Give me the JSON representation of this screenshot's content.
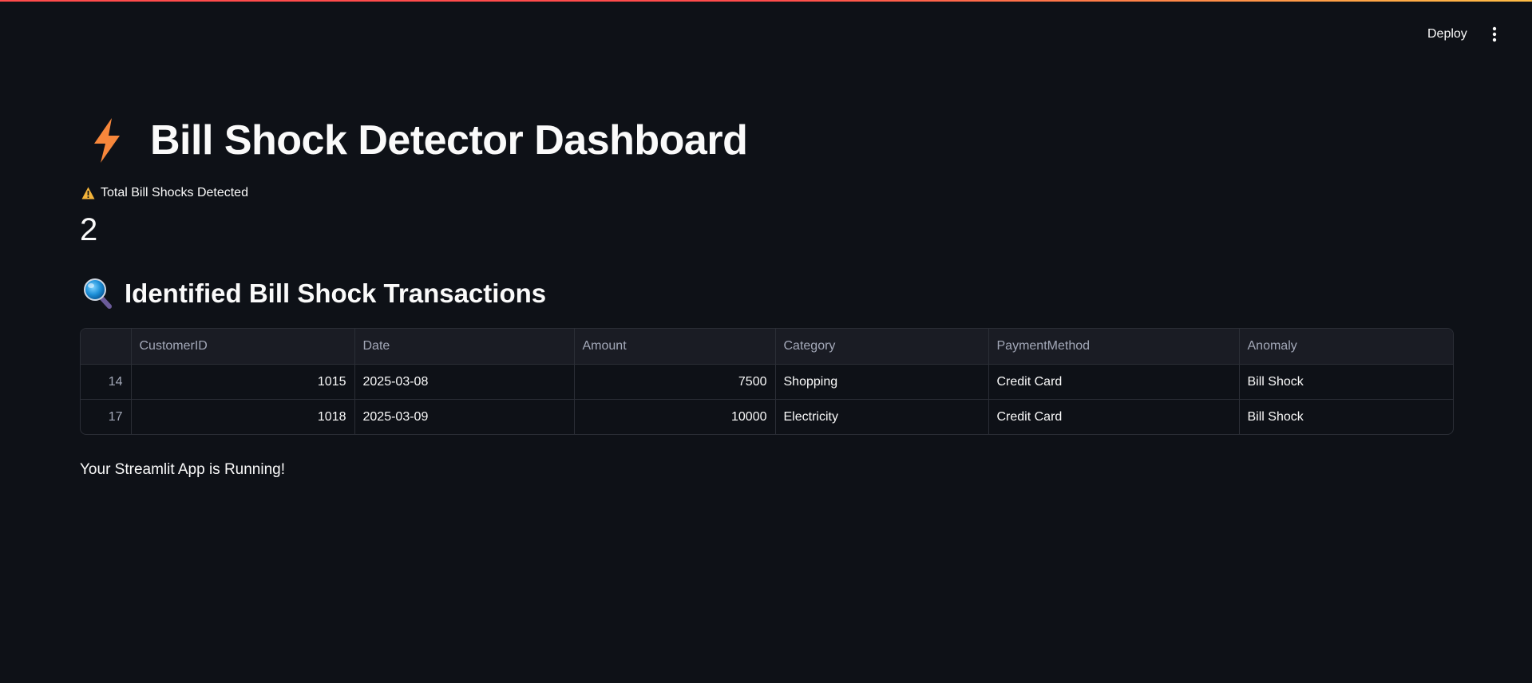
{
  "header": {
    "deploy_label": "Deploy"
  },
  "title": {
    "icon": "lightning-bolt-icon",
    "text": "Bill Shock Detector Dashboard"
  },
  "metric": {
    "icon": "warning-icon",
    "label": "Total Bill Shocks Detected",
    "value": "2"
  },
  "section": {
    "icon": "magnifier-icon",
    "title": "Identified Bill Shock Transactions"
  },
  "table": {
    "columns": [
      "",
      "CustomerID",
      "Date",
      "Amount",
      "Category",
      "PaymentMethod",
      "Anomaly"
    ],
    "rows": [
      {
        "index": "14",
        "CustomerID": "1015",
        "Date": "2025-03-08",
        "Amount": "7500",
        "Category": "Shopping",
        "PaymentMethod": "Credit Card",
        "Anomaly": "Bill Shock"
      },
      {
        "index": "17",
        "CustomerID": "1018",
        "Date": "2025-03-09",
        "Amount": "10000",
        "Category": "Electricity",
        "PaymentMethod": "Credit Card",
        "Anomaly": "Bill Shock"
      }
    ]
  },
  "footer": {
    "text": "Your Streamlit App is Running!"
  },
  "colors": {
    "background": "#0e1117",
    "text": "#fafafa",
    "muted": "#a3a8b8",
    "border": "#2b2e36",
    "bolt": "#f7873b",
    "warning": "#f4b43a",
    "accent_line": "#ff4b4b"
  }
}
